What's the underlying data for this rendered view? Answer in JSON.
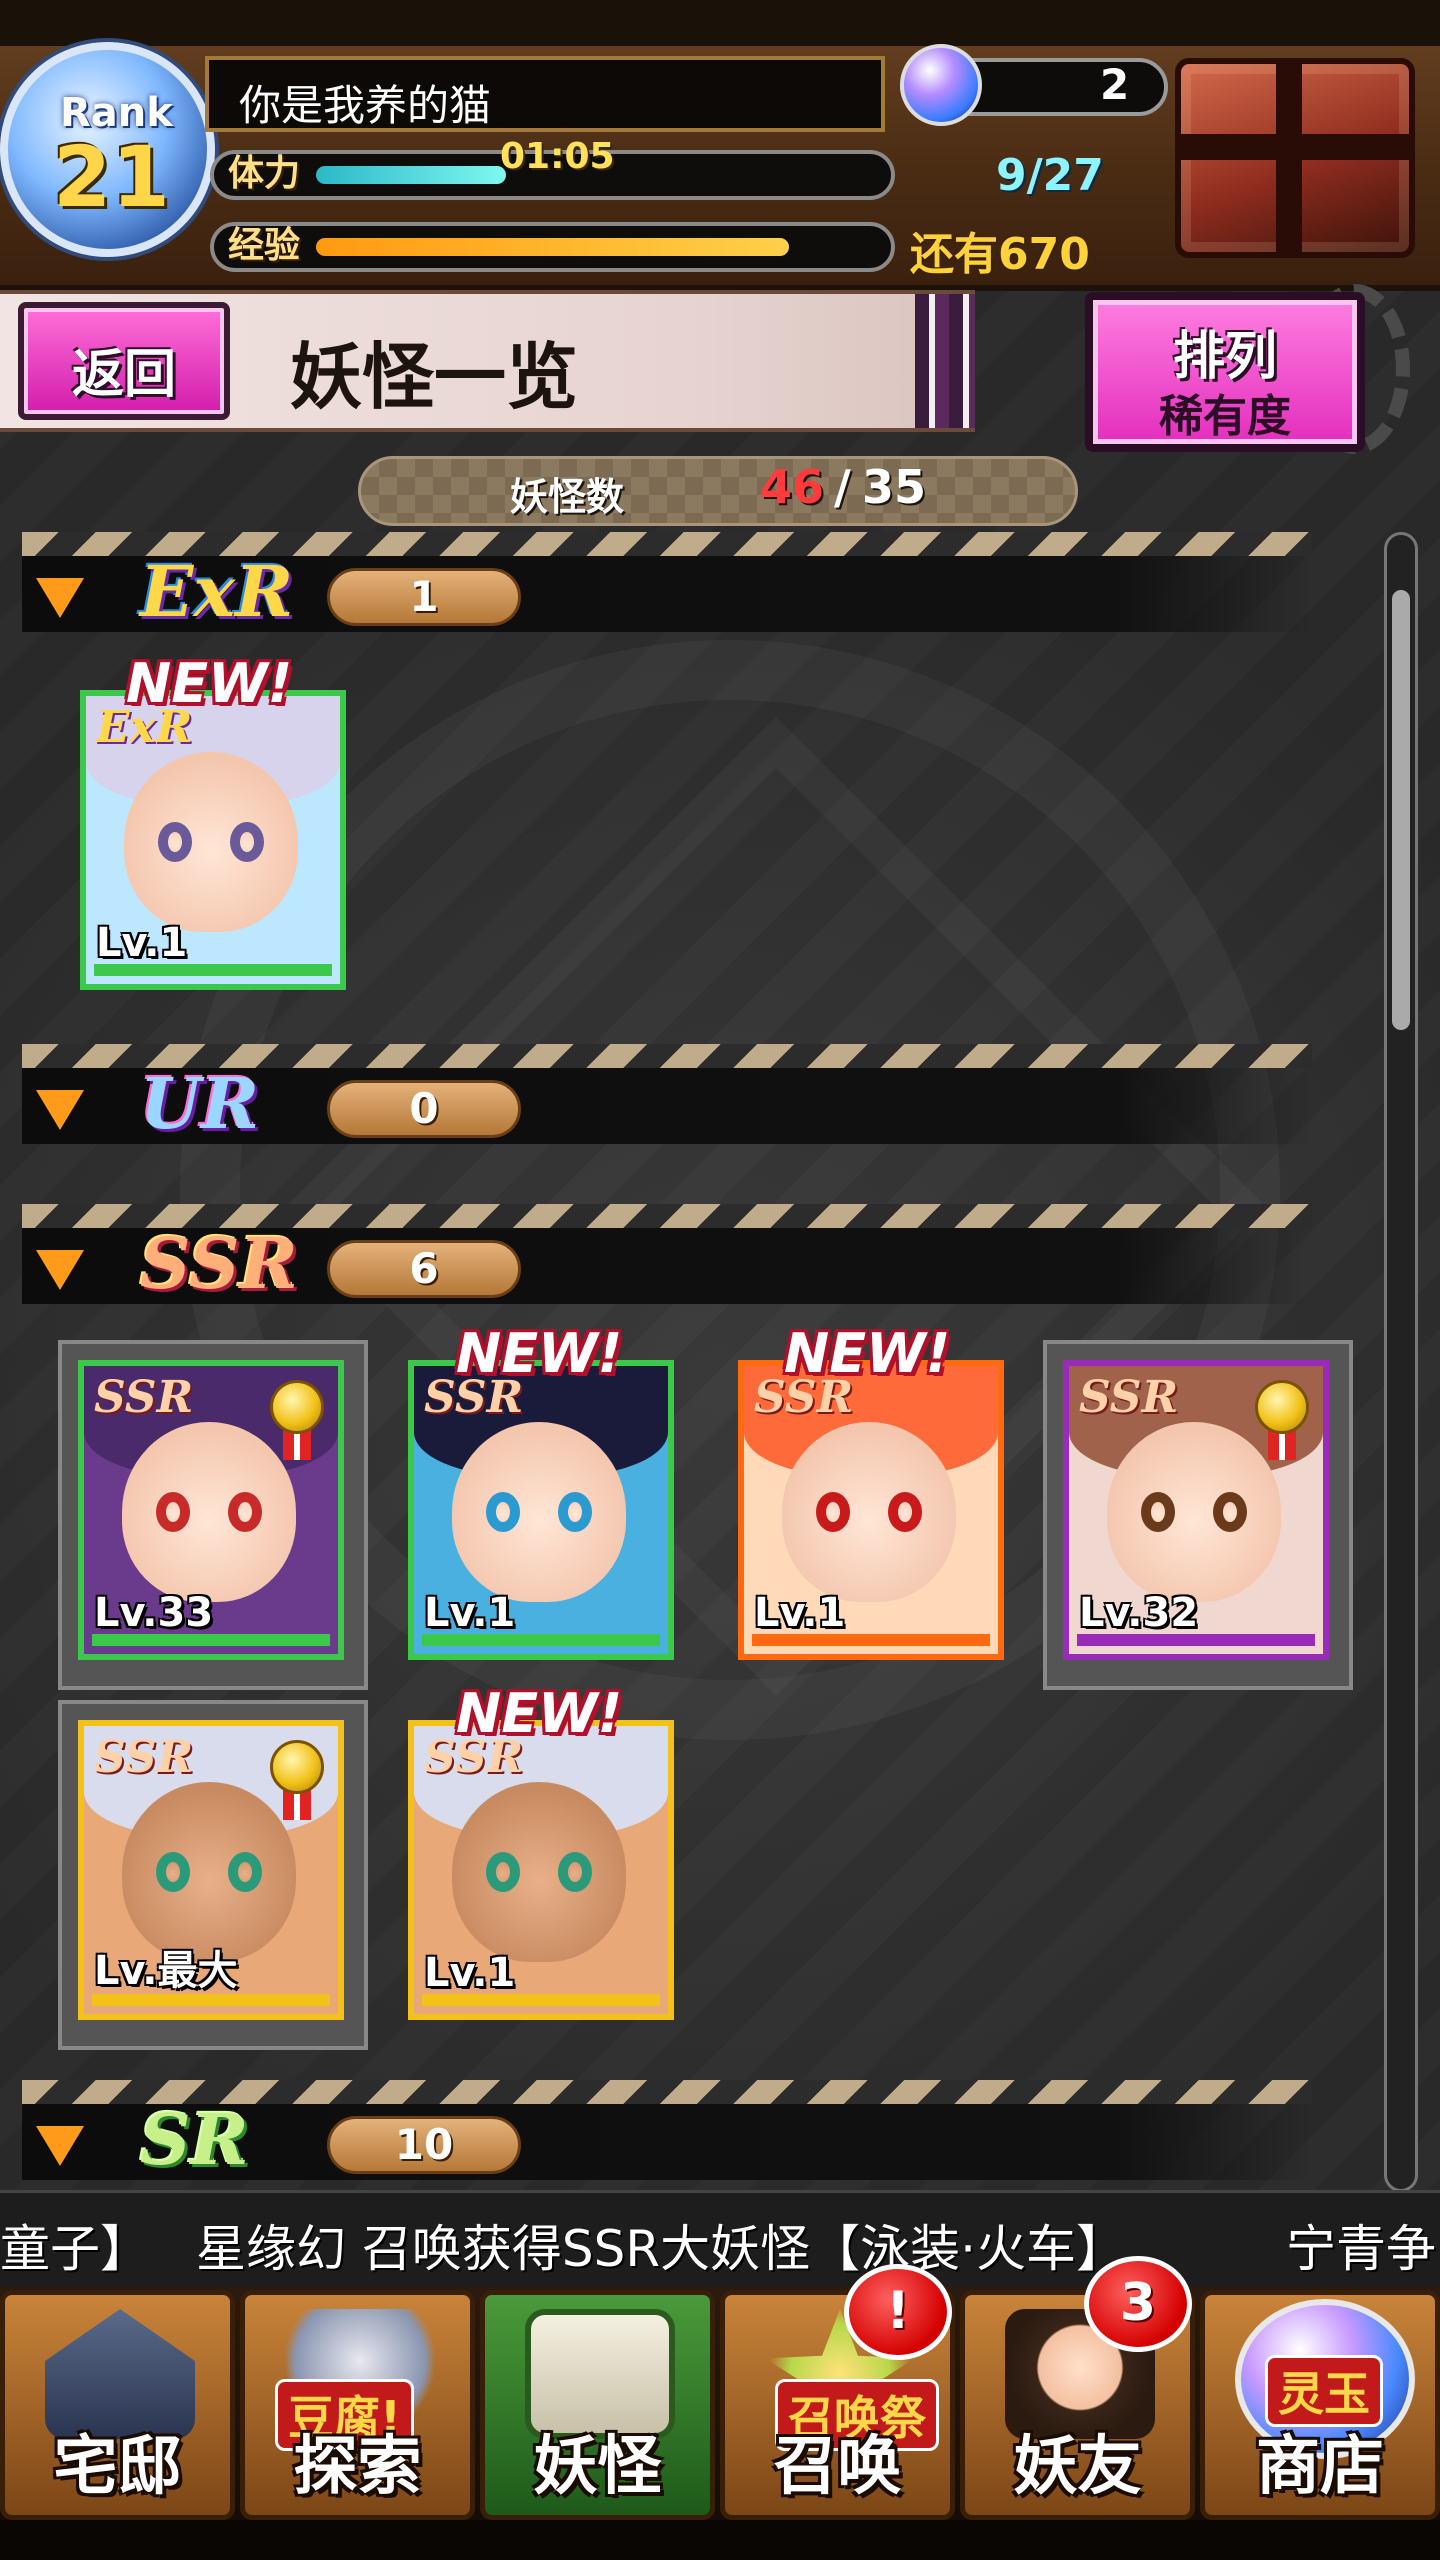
{
  "header": {
    "rank_label": "Rank",
    "rank_value": "21",
    "player_name": "你是我养的猫",
    "orb_count": "2",
    "stamina_label": "体力",
    "stamina_timer": "01:05",
    "stamina_count": "9/27",
    "stamina_fraction": 0.333,
    "exp_label": "经验",
    "exp_remaining": "还有670",
    "exp_fraction": 0.83
  },
  "title_bar": {
    "back_label": "返回",
    "title": "妖怪一览",
    "sort_label": "排列",
    "sort_value": "稀有度"
  },
  "yokai_count": {
    "label": "妖怪数",
    "current": "46",
    "separator": "/",
    "max": "35"
  },
  "colors": {
    "accent_pink": "#e32ebd",
    "count_red": "#ff3b3b",
    "stamina_cyan": "#5ff0ea",
    "exp_orange": "#ffb020",
    "section_arrow": "#ff9a1a"
  },
  "sections": [
    {
      "rarity": "ExR",
      "count": "1",
      "cards": [
        {
          "badge": "ExR",
          "level": "Lv.1",
          "new_label": "NEW!",
          "frame_color": "#3cc84a",
          "medal": false
        }
      ]
    },
    {
      "rarity": "UR",
      "count": "0",
      "cards": []
    },
    {
      "rarity": "SSR",
      "count": "6",
      "cards": [
        {
          "badge": "SSR",
          "level": "Lv.33",
          "new_label": "",
          "frame_color": "#3cc84a",
          "medal": true
        },
        {
          "badge": "SSR",
          "level": "Lv.1",
          "new_label": "NEW!",
          "frame_color": "#3cc84a",
          "medal": false
        },
        {
          "badge": "SSR",
          "level": "Lv.1",
          "new_label": "NEW!",
          "frame_color": "#ff6a10",
          "medal": false
        },
        {
          "badge": "SSR",
          "level": "Lv.32",
          "new_label": "",
          "frame_color": "#9a2ab8",
          "medal": true
        },
        {
          "badge": "SSR",
          "level": "Lv.最大",
          "new_label": "",
          "frame_color": "#f2c21a",
          "medal": true
        },
        {
          "badge": "SSR",
          "level": "Lv.1",
          "new_label": "NEW!",
          "frame_color": "#f2c21a",
          "medal": false
        }
      ]
    },
    {
      "rarity": "SR",
      "count": "10",
      "cards": []
    }
  ],
  "ticker": {
    "left_fragment": "童子】",
    "message": "星缘幻 召唤获得SSR大妖怪【泳装·火车】",
    "right_fragment": "宁青争"
  },
  "nav": [
    {
      "label": "宅邸",
      "icon": "house-icon",
      "tag": "",
      "badge": ""
    },
    {
      "label": "探索",
      "icon": "explore-icon",
      "tag": "豆腐!",
      "badge": ""
    },
    {
      "label": "妖怪",
      "icon": "scroll-icon",
      "tag": "",
      "badge": ""
    },
    {
      "label": "召唤",
      "icon": "summon-star-icon",
      "tag": "召唤祭",
      "badge": "!"
    },
    {
      "label": "妖友",
      "icon": "friend-icon",
      "tag": "",
      "badge": "3"
    },
    {
      "label": "商店",
      "icon": "orb-shop-icon",
      "tag": "灵玉",
      "badge": ""
    }
  ]
}
